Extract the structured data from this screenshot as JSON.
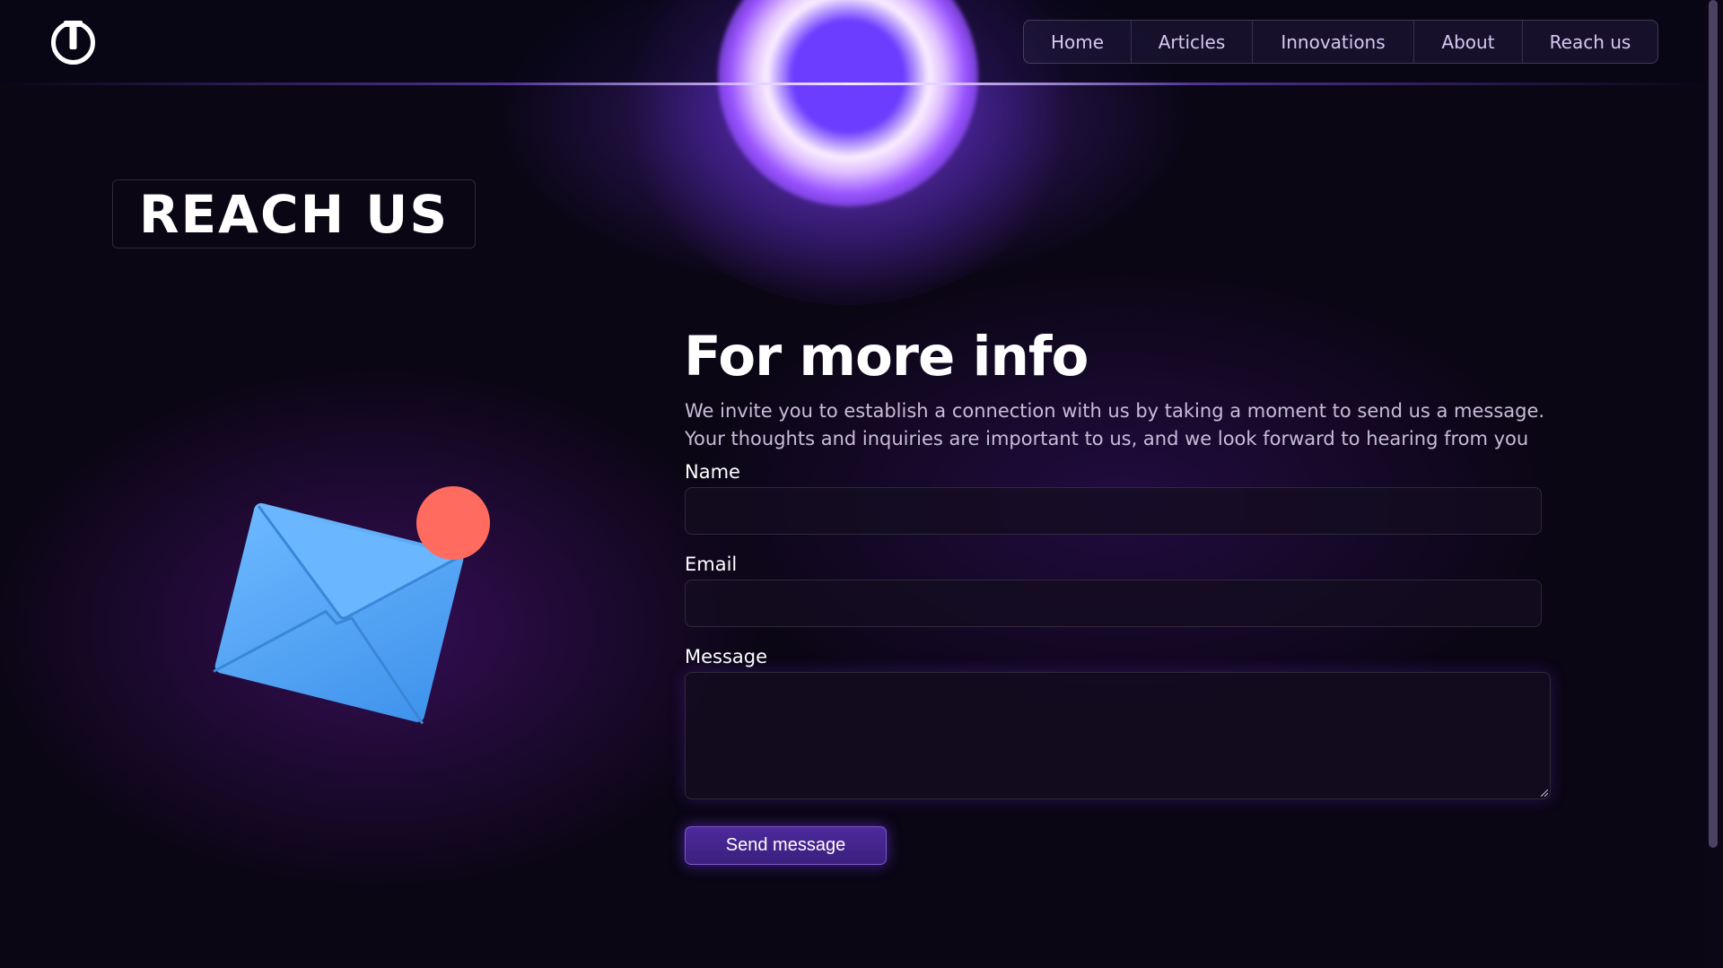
{
  "header": {
    "logo_icon": "power-logo-icon",
    "nav": [
      {
        "label": "Home"
      },
      {
        "label": "Articles"
      },
      {
        "label": "Innovations"
      },
      {
        "label": "About"
      },
      {
        "label": "Reach us"
      }
    ]
  },
  "page": {
    "title": "REACH US"
  },
  "illustration": {
    "icon": "envelope-notification-icon",
    "colors": {
      "envelope": "#5aa9f5",
      "badge": "#ff6b5f"
    }
  },
  "form": {
    "heading": "For more info",
    "intro": "We invite you to establish a connection with us by taking a moment to send us a message. Your thoughts and inquiries are important to us, and we look forward to hearing from you",
    "fields": {
      "name": {
        "label": "Name",
        "value": "",
        "placeholder": ""
      },
      "email": {
        "label": "Email",
        "value": "",
        "placeholder": ""
      },
      "message": {
        "label": "Message",
        "value": "",
        "placeholder": ""
      }
    },
    "submit_label": "Send message"
  },
  "theme": {
    "background": "#0a0614",
    "accent": "#6c3cff",
    "button": "#3b1f7e"
  }
}
